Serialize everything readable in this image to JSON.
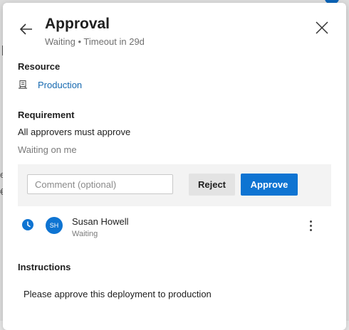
{
  "background": {
    "fragment_a": "e",
    "fragment_b": "€"
  },
  "panel": {
    "title": "Approval",
    "subtitle": "Waiting • Timeout in 29d",
    "resource": {
      "label": "Resource",
      "icon": "server-icon",
      "name": "Production"
    },
    "requirement": {
      "label": "Requirement",
      "text": "All approvers must approve",
      "status": "Waiting on me"
    },
    "actions": {
      "comment_placeholder": "Comment (optional)",
      "comment_value": "",
      "reject_label": "Reject",
      "approve_label": "Approve"
    },
    "approvers": [
      {
        "initials": "SH",
        "name": "Susan Howell",
        "status": "Waiting",
        "status_icon": "clock-icon"
      }
    ],
    "instructions": {
      "label": "Instructions",
      "text": "Please approve this deployment to production"
    }
  },
  "colors": {
    "accent": "#0e74d2",
    "link": "#1669b0"
  }
}
